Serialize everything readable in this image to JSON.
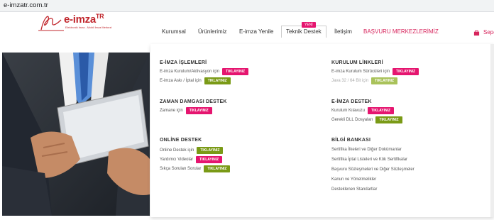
{
  "browser": {
    "url": "e-imzatr.com.tr"
  },
  "brand": {
    "name": "e-imza",
    "suffix": "TR",
    "tagline": "Elektronik İmza - Mobil İmza Merkezi"
  },
  "nav": {
    "items": [
      {
        "label": "Kurumsal"
      },
      {
        "label": "Ürünlerimiz"
      },
      {
        "label": "E-imza Yenile"
      },
      {
        "label": "Teknik Destek"
      },
      {
        "label": "İletişim"
      },
      {
        "label": "BAŞVURU MERKEZLERİMİZ"
      },
      {
        "label": "Sepe"
      }
    ],
    "badge": "YENİ",
    "colors": {
      "accent": "#d7255d"
    }
  },
  "menu": {
    "imza": {
      "title": "E-İMZA İŞLEMLERİ",
      "rows": [
        {
          "text": "E-imza Kurulum/Aktivasyon için",
          "btn": "TIKLAYINIZ"
        },
        {
          "text": "E-imza Askı / İptal için",
          "btn": "TIKLAYINIZ"
        }
      ]
    },
    "zaman": {
      "title": "ZAMAN DAMGASI DESTEK",
      "rows": [
        {
          "text": "Zamane için",
          "btn": "TIKLAYINIZ"
        }
      ]
    },
    "online": {
      "title": "ONLİNE DESTEK",
      "rows": [
        {
          "text": "Online Destek için",
          "btn": "TIKLAYINIZ"
        },
        {
          "text": "Yardımcı Videolar",
          "btn": "TIKLAYINIZ"
        },
        {
          "text": "Sıkça Sorulan Sorular",
          "btn": "TIKLAYINIZ"
        }
      ]
    },
    "kurulum": {
      "title": "KURULUM LİNKLERİ",
      "rows": [
        {
          "text": "E-imza Kurulum Sürücüleri için",
          "btn": "TIKLAYINIZ"
        },
        {
          "text": "Java 32 / 64 Bit için",
          "btn": "TIKLAYINIZ"
        }
      ]
    },
    "destek": {
      "title": "E-İMZA DESTEK",
      "rows": [
        {
          "text": "Kurulum Kılavuzu",
          "btn": "TIKLAYINIZ"
        },
        {
          "text": "Gerekli DLL Dosyaları",
          "btn": "TIKLAYINIZ"
        }
      ]
    },
    "bilgi": {
      "title": "BİLGİ BANKASI",
      "links": [
        "Sertifika İlkeleri ve Diğer Dokümanlar",
        "Sertifika İptal Listeleri ve Kök Sertifikalar",
        "Başvuru Sözleşmeleri ve Diğer Sözleşmeler",
        "Kanun ve Yönetmelikler",
        "Desteklenen Standartlar"
      ]
    }
  }
}
